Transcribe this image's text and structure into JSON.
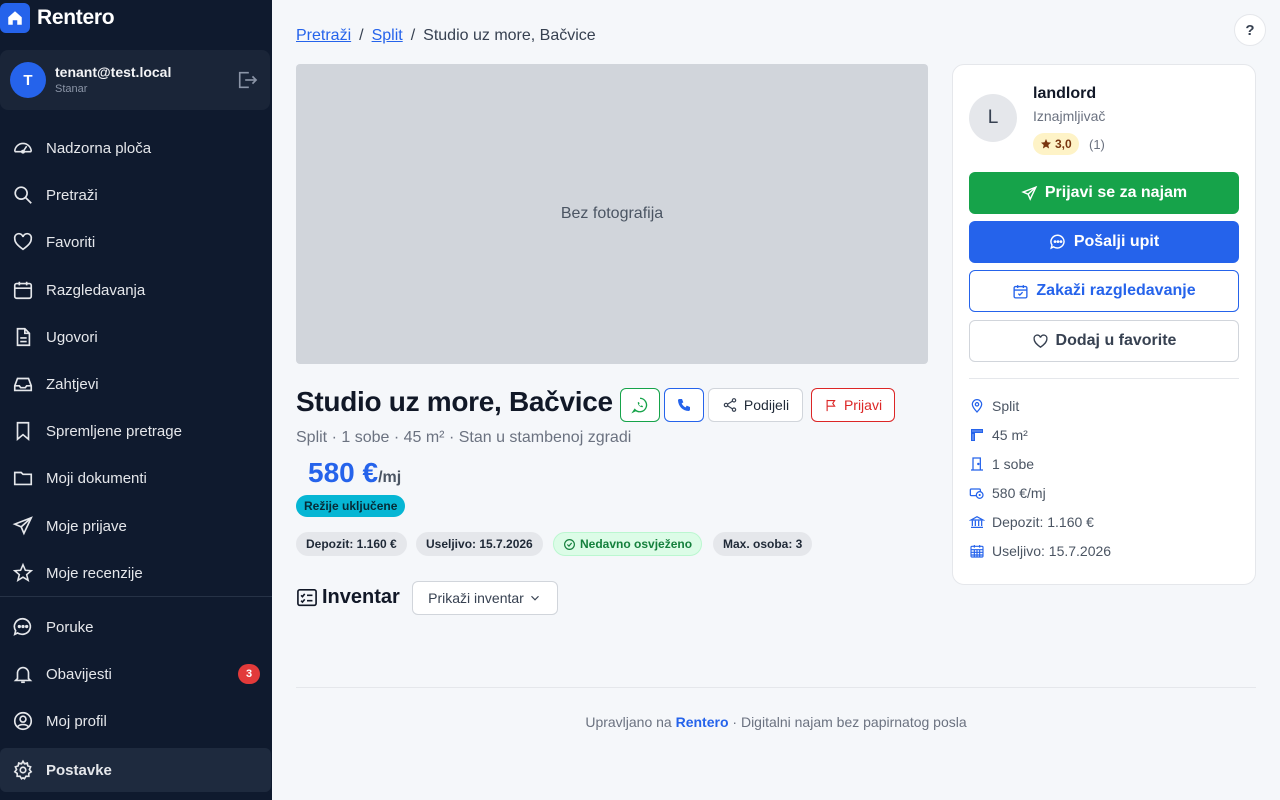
{
  "app": {
    "name": "Rentero"
  },
  "user": {
    "initial": "T",
    "email": "tenant@test.local",
    "role": "Stanar"
  },
  "sidebar": {
    "items": [
      {
        "label": "Nadzorna ploča",
        "icon": "dashboard-icon"
      },
      {
        "label": "Pretraži",
        "icon": "search-icon"
      },
      {
        "label": "Favoriti",
        "icon": "heart-icon"
      },
      {
        "label": "Razgledavanja",
        "icon": "calendar-icon"
      },
      {
        "label": "Ugovori",
        "icon": "document-icon"
      },
      {
        "label": "Zahtjevi",
        "icon": "inbox-icon"
      },
      {
        "label": "Spremljene pretrage",
        "icon": "bookmark-icon"
      },
      {
        "label": "Moji dokumenti",
        "icon": "folder-icon"
      },
      {
        "label": "Moje prijave",
        "icon": "send-icon"
      },
      {
        "label": "Moje recenzije",
        "icon": "star-icon"
      }
    ],
    "bottom_items": [
      {
        "label": "Poruke",
        "icon": "chat-icon"
      },
      {
        "label": "Obavijesti",
        "icon": "bell-icon",
        "badge": "3"
      },
      {
        "label": "Moj profil",
        "icon": "user-icon"
      },
      {
        "label": "Postavke",
        "icon": "gear-icon",
        "active": true
      }
    ]
  },
  "help": {
    "label": "?"
  },
  "breadcrumb": {
    "search": "Pretraži",
    "city": "Split",
    "current": "Studio uz more, Bačvice",
    "sep": "/"
  },
  "listing": {
    "no_photo": "Bez fotografija",
    "title": "Studio uz more, Bačvice",
    "share_label": "Podijeli",
    "report_label": "Prijavi",
    "subtitle": "Split · 1 sobe · 45 m² · Stan u stambenoj zgradi",
    "price": "580 €",
    "price_unit": "/mj",
    "utilities": "Režije uključene",
    "chips": {
      "deposit": "Depozit: 1.160 €",
      "available": "Useljivo: 15.7.2026",
      "refreshed": "Nedavno osvježeno",
      "max_persons": "Max. osoba: 3"
    },
    "inventory_title": "Inventar",
    "inventory_button": "Prikaži inventar"
  },
  "landlord": {
    "initial": "L",
    "name": "landlord",
    "role": "Iznajmljivač",
    "rating": "3,0",
    "rating_count": "(1)"
  },
  "actions": {
    "apply": "Prijavi se za najam",
    "inquiry": "Pošalji upit",
    "schedule": "Zakaži razgledavanje",
    "favorite": "Dodaj u favorite"
  },
  "details": {
    "city": "Split",
    "area": "45 m²",
    "rooms": "1 sobe",
    "price": "580 €/mj",
    "deposit": "Depozit: 1.160 €",
    "available": "Useljivo: 15.7.2026"
  },
  "footer": {
    "prefix": "Upravljano na",
    "brand": "Rentero",
    "suffix": "· Digitalni najam bez papirnatog posla"
  },
  "colors": {
    "sidebar_bg": "#0f1a2e",
    "accent": "#2563eb",
    "success": "#16a34a",
    "danger": "#dc2626"
  }
}
